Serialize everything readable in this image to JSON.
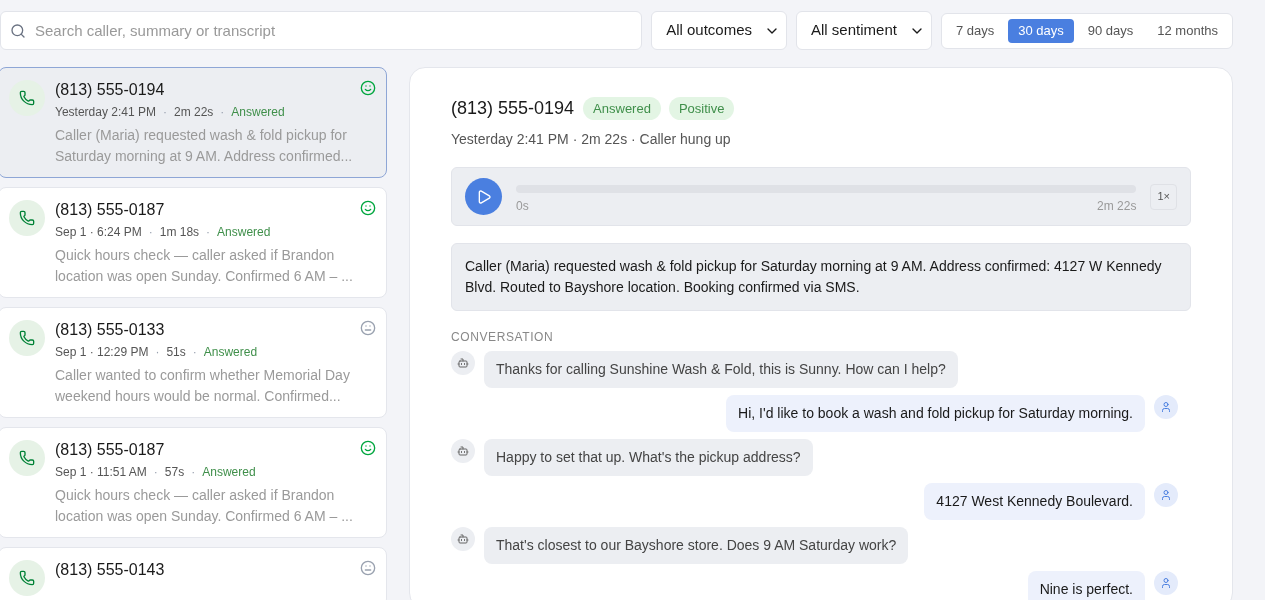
{
  "search": {
    "placeholder": "Search caller, summary or transcript"
  },
  "filters": [
    {
      "label": "All outcomes"
    },
    {
      "label": "All sentiment"
    }
  ],
  "ranges": [
    {
      "label": "7 days",
      "selected": false
    },
    {
      "label": "30 days",
      "selected": true
    },
    {
      "label": "90 days",
      "selected": false
    },
    {
      "label": "12 months",
      "selected": false
    }
  ],
  "calls": [
    {
      "phone": "(813) 555-0194",
      "time": "Yesterday 2:41 PM",
      "sep_1": "·",
      "duration": "2m 22s",
      "sep_2": "·",
      "outcome": "Answered",
      "kind": "positive",
      "summary": "Caller (Maria) requested wash & fold pickup for Saturday morning at 9 AM. Address confirmed...",
      "selected": true
    },
    {
      "phone": "(813) 555-0187",
      "time": "Sep 1 · 6:24 PM",
      "sep_1": "·",
      "duration": "1m 18s",
      "sep_2": "·",
      "outcome": "Answered",
      "kind": "positive",
      "summary": "Quick hours check — caller asked if Brandon location was open Sunday. Confirmed 6 AM – ...",
      "selected": false
    },
    {
      "phone": "(813) 555-0133",
      "time": "Sep 1 · 12:29 PM",
      "sep_1": "·",
      "duration": "51s",
      "sep_2": "·",
      "outcome": "Answered",
      "kind": "neutral",
      "summary": "Caller wanted to confirm whether Memorial Day weekend hours would be normal. Confirmed...",
      "selected": false
    },
    {
      "phone": "(813) 555-0187",
      "time": "Sep 1 · 11:51 AM",
      "sep_1": "·",
      "duration": "57s",
      "sep_2": "·",
      "outcome": "Answered",
      "kind": "positive",
      "summary": "Quick hours check — caller asked if Brandon location was open Sunday. Confirmed 6 AM – ...",
      "selected": false
    },
    {
      "phone": "(813) 555-0143",
      "kind": "neutral",
      "selected": false
    }
  ],
  "detail": {
    "phone": "(813) 555-0194",
    "badges": [
      {
        "label": "Answered"
      },
      {
        "label": "Positive"
      }
    ],
    "meta": "Yesterday 2:41 PM · 2m 22s · Caller hung up",
    "player": {
      "level": 0,
      "start": "0s",
      "end": "2m 22s",
      "speed": "1×"
    },
    "summary": "Caller (Maria) requested wash & fold pickup for Saturday morning at 9 AM. Address confirmed: 4127 W Kennedy Blvd. Routed to Bayshore location. Booking confirmed via SMS.",
    "conversation_title": "CONVERSATION",
    "messages": [
      {
        "kind": "agent",
        "text": "Thanks for calling Sunshine Wash & Fold, this is Sunny. How can I help?"
      },
      {
        "kind": "caller",
        "text": "Hi, I'd like to book a wash and fold pickup for Saturday morning."
      },
      {
        "kind": "agent",
        "text": "Happy to set that up. What's the pickup address?"
      },
      {
        "kind": "caller",
        "text": "4127 West Kennedy Boulevard."
      },
      {
        "kind": "agent",
        "text": "That's closest to our Bayshore store. Does 9 AM Saturday work?"
      },
      {
        "kind": "caller",
        "text": "Nine is perfect."
      }
    ]
  }
}
